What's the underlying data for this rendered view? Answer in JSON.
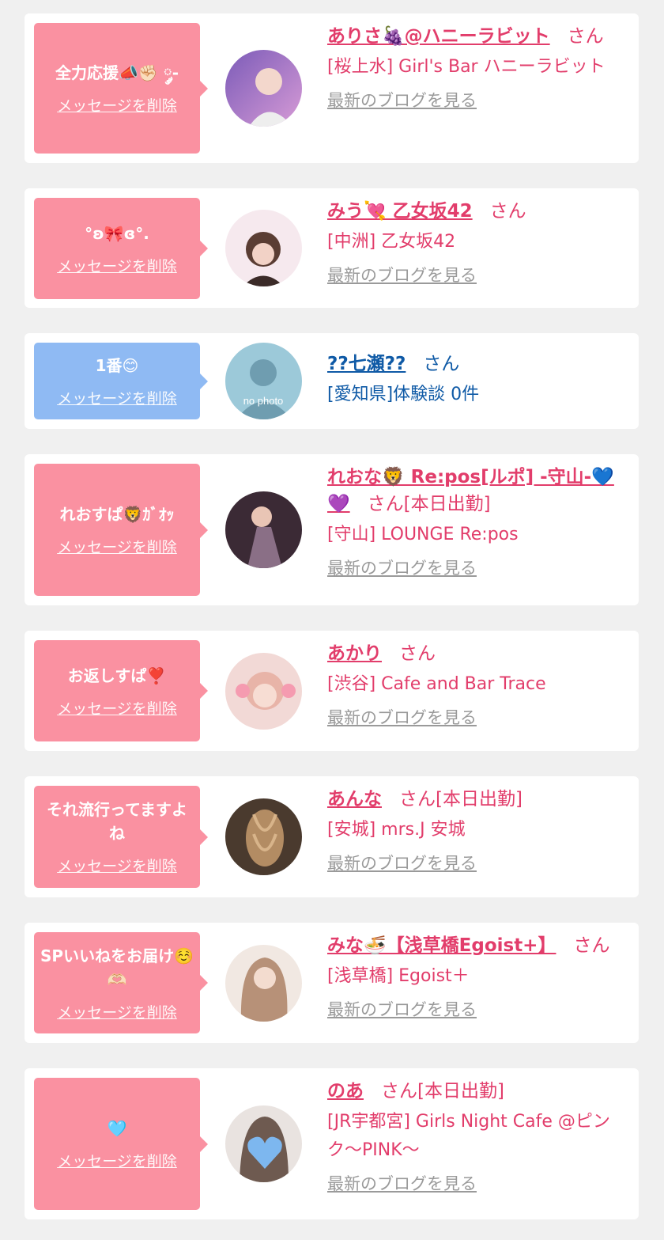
{
  "items": [
    {
      "message": "全力応援📣✊🏻 ༘-",
      "delete_label": "メッセージを削除",
      "name": "ありさ🍇@ハニーラビット",
      "suffix": "さん",
      "status": "",
      "shop": "[桜上水] Girl's Bar ハニーラビット",
      "blog_label": "最新のブログを見る",
      "theme": "pink",
      "avatar_colors": [
        "#7b5bb8",
        "#d79bd6"
      ]
    },
    {
      "message": "°ʚ🎀ɞ°.",
      "delete_label": "メッセージを削除",
      "name": "みう💘 乙女坂42",
      "suffix": "さん",
      "status": "",
      "shop": "[中洲] 乙女坂42",
      "blog_label": "最新のブログを見る",
      "theme": "pink",
      "avatar_colors": [
        "#f6e9ee",
        "#5a3d33"
      ]
    },
    {
      "message": "1番😊",
      "delete_label": "メッセージを削除",
      "name": "??七瀬??",
      "suffix": "さん",
      "status": "",
      "shop": "[愛知県]体験談 0件",
      "blog_label": "",
      "theme": "blue",
      "avatar_text": "no photo",
      "avatar_colors": [
        "#9cc9d9",
        "#6f9db0"
      ]
    },
    {
      "message": "れおすぱ🦁ｶﾞｵｯ",
      "delete_label": "メッセージを削除",
      "name": "れおな🦁 Re:pos[ルポ] -守山-💙💜",
      "suffix": "さん",
      "status": "[本日出勤]",
      "shop": "[守山] LOUNGE Re:pos",
      "blog_label": "最新のブログを見る",
      "theme": "pink",
      "avatar_colors": [
        "#3b2a35",
        "#8a6f86"
      ]
    },
    {
      "message": "お返しすぱ❣️",
      "delete_label": "メッセージを削除",
      "name": "あかり",
      "suffix": "さん",
      "status": "",
      "shop": "[渋谷] Cafe and Bar Trace",
      "blog_label": "最新のブログを見る",
      "theme": "pink",
      "avatar_colors": [
        "#f2d9d6",
        "#e8b4a8"
      ]
    },
    {
      "message": "それ流行ってますよね",
      "delete_label": "メッセージを削除",
      "name": "あんな",
      "suffix": "さん",
      "status": "[本日出勤]",
      "shop": "[安城] mrs.J 安城",
      "blog_label": "最新のブログを見る",
      "theme": "pink",
      "avatar_colors": [
        "#4a3a2e",
        "#b38c63"
      ]
    },
    {
      "message": "SPいいねをお届け☺️🫶🏻",
      "delete_label": "メッセージを削除",
      "name": "みな🍜【浅草橋Egoist+】",
      "suffix": "さん",
      "status": "",
      "shop": "[浅草橋] Egoist＋",
      "blog_label": "最新のブログを見る",
      "theme": "pink",
      "avatar_colors": [
        "#f1e8e2",
        "#b79178"
      ]
    },
    {
      "message": "🩵",
      "delete_label": "メッセージを削除",
      "name": "のあ",
      "suffix": "さん",
      "status": "[本日出勤]",
      "shop": "[JR宇都宮] Girls Night Cafe @ピンク〜PINK〜",
      "blog_label": "最新のブログを見る",
      "theme": "pink",
      "avatar_colors": [
        "#e9e3e0",
        "#7db7ef"
      ]
    }
  ]
}
